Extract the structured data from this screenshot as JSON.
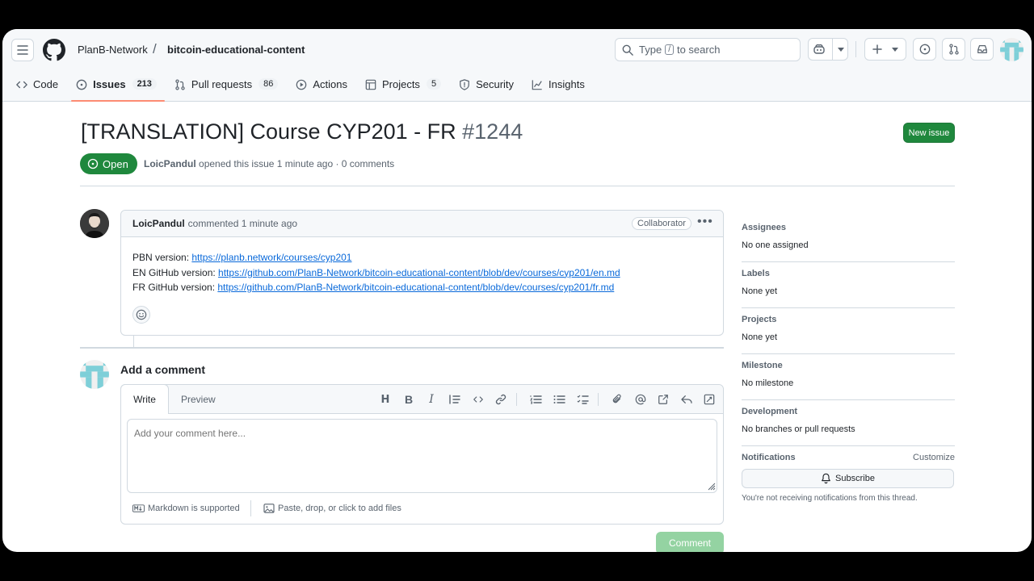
{
  "header": {
    "owner": "PlanB-Network",
    "separator": "/",
    "repo": "bitcoin-educational-content",
    "search": {
      "prefix": "Type",
      "key": "/",
      "suffix": "to search"
    }
  },
  "tabs": [
    {
      "label": "Code",
      "count": ""
    },
    {
      "label": "Issues",
      "count": "213"
    },
    {
      "label": "Pull requests",
      "count": "86"
    },
    {
      "label": "Actions",
      "count": ""
    },
    {
      "label": "Projects",
      "count": "5"
    },
    {
      "label": "Security",
      "count": ""
    },
    {
      "label": "Insights",
      "count": ""
    }
  ],
  "issue": {
    "title": "[TRANSLATION] Course CYP201 - FR",
    "number": "#1244",
    "new_issue_label": "New issue",
    "state": "Open",
    "author": "LoicPandul",
    "meta_text": "opened this issue 1 minute ago · 0 comments"
  },
  "comment": {
    "author": "LoicPandul",
    "time_text": "commented 1 minute ago",
    "role_badge": "Collaborator",
    "lines": [
      {
        "label": "PBN version: ",
        "link": "https://planb.network/courses/cyp201"
      },
      {
        "label": "EN GitHub version: ",
        "link": "https://github.com/PlanB-Network/bitcoin-educational-content/blob/dev/courses/cyp201/en.md"
      },
      {
        "label": "FR GitHub version: ",
        "link": "https://github.com/PlanB-Network/bitcoin-educational-content/blob/dev/courses/cyp201/fr.md"
      }
    ]
  },
  "composer": {
    "title": "Add a comment",
    "tab_write": "Write",
    "tab_preview": "Preview",
    "placeholder": "Add your comment here...",
    "markdown_note": "Markdown is supported",
    "attach_note": "Paste, drop, or click to add files",
    "submit_label": "Comment"
  },
  "sidebar": {
    "assignees": {
      "label": "Assignees",
      "value": "No one assigned"
    },
    "labels": {
      "label": "Labels",
      "value": "None yet"
    },
    "projects": {
      "label": "Projects",
      "value": "None yet"
    },
    "milestone": {
      "label": "Milestone",
      "value": "No milestone"
    },
    "development": {
      "label": "Development",
      "value": "No branches or pull requests"
    },
    "notifications": {
      "label": "Notifications",
      "customize": "Customize",
      "subscribe": "Subscribe",
      "note": "You're not receiving notifications from this thread."
    }
  },
  "colors": {
    "accent_green": "#1f883d",
    "link": "#0969da",
    "tab_underline": "#fd8c73"
  }
}
